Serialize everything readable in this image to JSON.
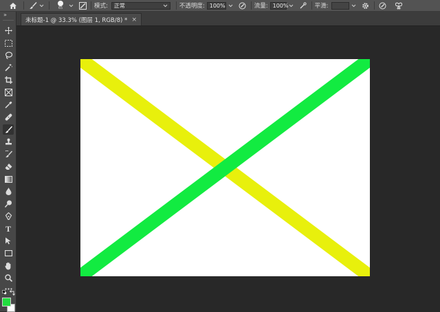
{
  "options": {
    "brush_size": "65",
    "mode_label": "模式:",
    "mode_value": "正常",
    "opacity_label": "不透明度:",
    "opacity_value": "100%",
    "flow_label": "流量:",
    "flow_value": "100%",
    "smoothing_label": "平滑:",
    "smoothing_value": ""
  },
  "document": {
    "tab_title": "未标题-1 @ 33.3% (图层 1, RGB/8) *",
    "close_glyph": "×",
    "canvas_background": "#ffffff",
    "strokes": [
      {
        "name": "yellow-diagonal",
        "color": "#e8f00c"
      },
      {
        "name": "green-diagonal",
        "color": "#12eb41"
      }
    ]
  },
  "toolbar": {
    "collapse_glyph": "»",
    "type_tool_glyph": "T",
    "foreground_color": "#22dd3f",
    "background_color": "#ffffff"
  }
}
